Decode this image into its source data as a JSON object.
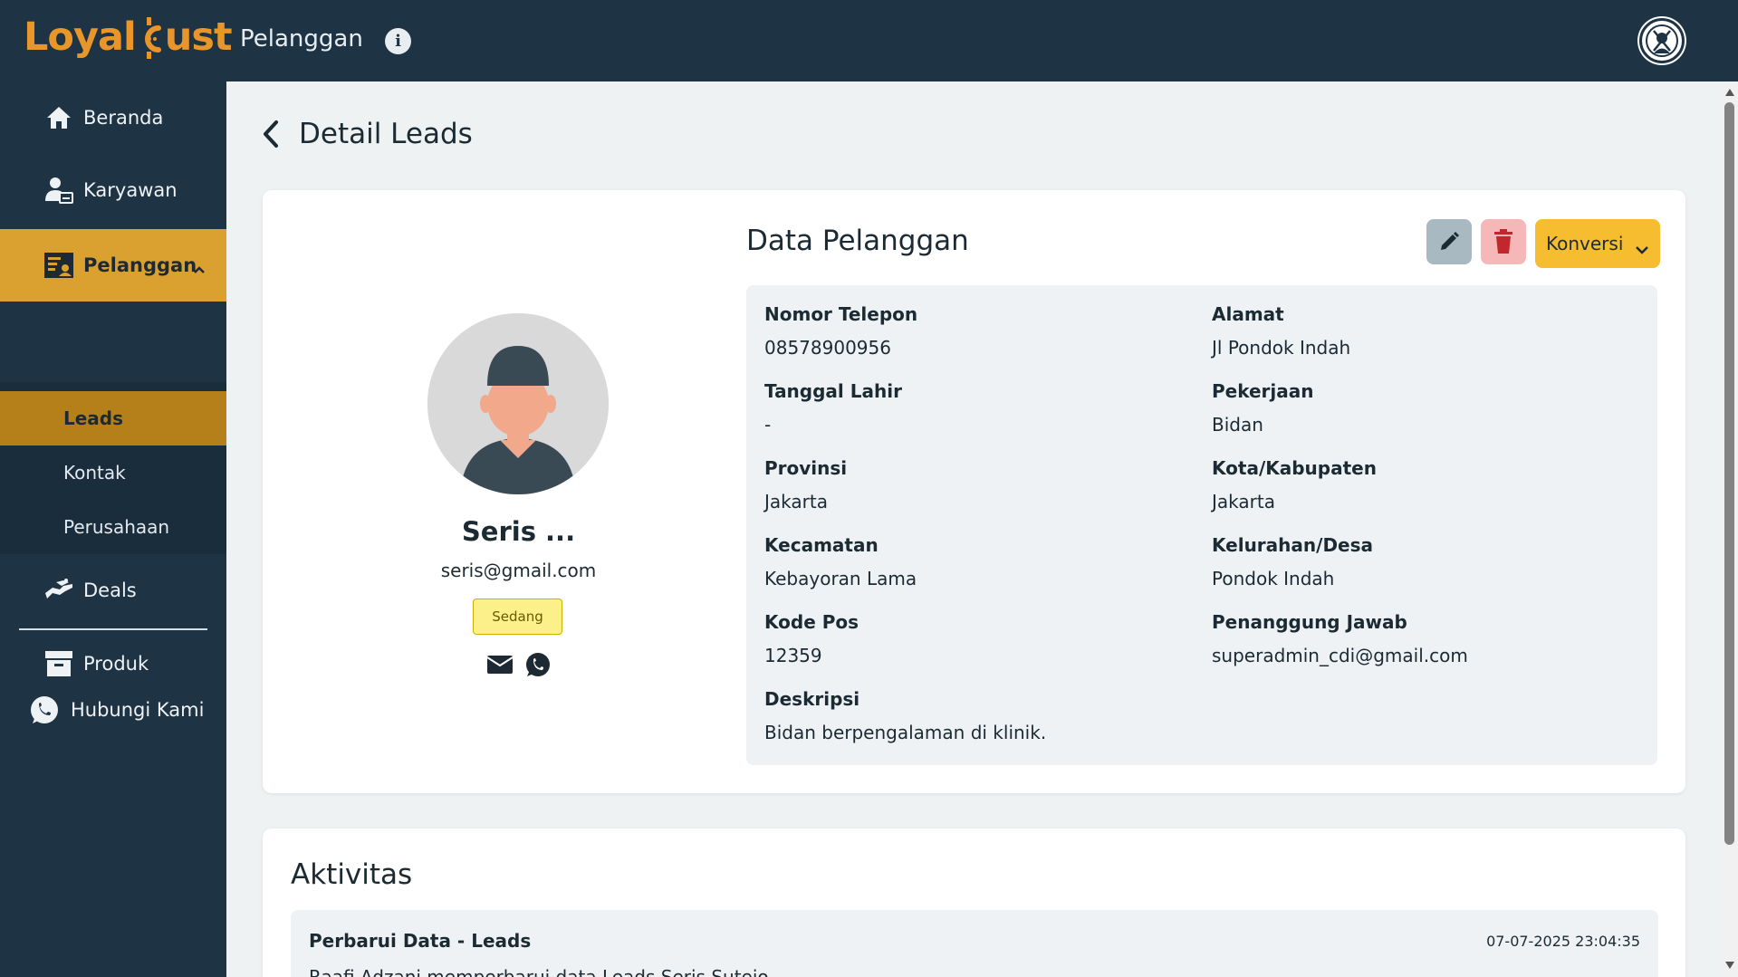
{
  "app": {
    "logo_left": "Loyal",
    "logo_right": "ust",
    "top_title": "Pelanggan"
  },
  "sidebar": {
    "items": [
      {
        "label": "Beranda",
        "icon": "home-icon"
      },
      {
        "label": "Karyawan",
        "icon": "employee-icon"
      },
      {
        "label": "Pelanggan",
        "icon": "customer-icon"
      },
      {
        "label": "Deals",
        "icon": "deals-icon"
      },
      {
        "label": "Produk",
        "icon": "archive-icon"
      }
    ],
    "sub_items": [
      {
        "label": "Leads"
      },
      {
        "label": "Kontak"
      },
      {
        "label": "Perusahaan"
      }
    ],
    "contact_label": "Hubungi Kami"
  },
  "page": {
    "title": "Detail Leads"
  },
  "profile": {
    "name": "Seris ...",
    "email": "seris@gmail.com",
    "badge": "Sedang"
  },
  "data": {
    "title": "Data Pelanggan",
    "convert_label": "Konversi",
    "fields": {
      "phone": {
        "label": "Nomor Telepon",
        "value": "08578900956"
      },
      "address": {
        "label": "Alamat",
        "value": "Jl Pondok Indah"
      },
      "birth": {
        "label": "Tanggal Lahir",
        "value": "-"
      },
      "job": {
        "label": "Pekerjaan",
        "value": "Bidan"
      },
      "province": {
        "label": "Provinsi",
        "value": "Jakarta"
      },
      "city": {
        "label": "Kota/Kabupaten",
        "value": "Jakarta"
      },
      "district": {
        "label": "Kecamatan",
        "value": "Kebayoran Lama"
      },
      "village": {
        "label": "Kelurahan/Desa",
        "value": "Pondok Indah"
      },
      "postal": {
        "label": "Kode Pos",
        "value": "12359"
      },
      "pic": {
        "label": "Penanggung Jawab",
        "value": "superadmin_cdi@gmail.com"
      },
      "desc": {
        "label": "Deskripsi",
        "value": "Bidan berpengalaman di klinik."
      }
    }
  },
  "activity": {
    "title": "Aktivitas",
    "items": [
      {
        "title": "Perbarui Data - Leads",
        "date": "07-07-2025 23:04:35",
        "text": "Raafi Adzani memperbarui data Leads Seris Sutejo"
      }
    ]
  },
  "colors": {
    "navy": "#1e3344",
    "accent": "#dba130",
    "accent_dark": "#b5801a",
    "logo": "#e8962a"
  }
}
